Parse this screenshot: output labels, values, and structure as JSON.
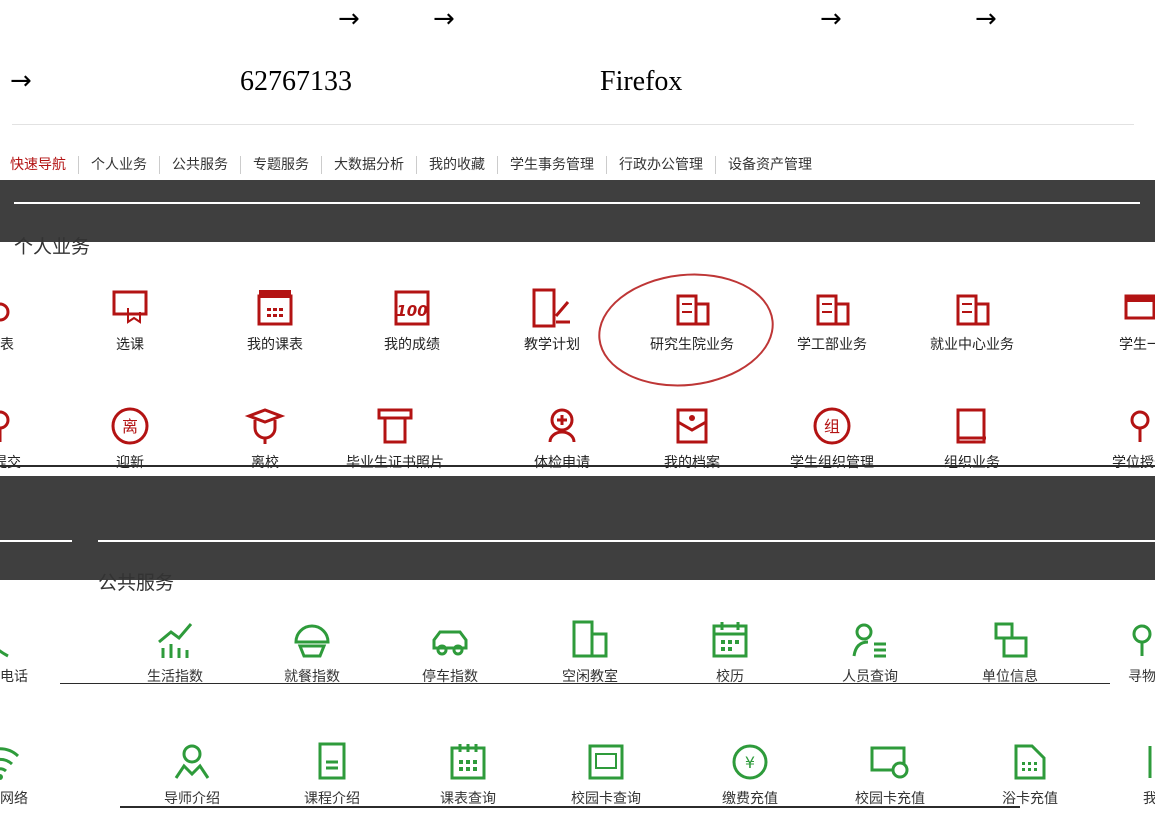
{
  "header": {
    "arrow": "→",
    "phone": "62767133",
    "browser": "Firefox"
  },
  "nav": {
    "tabs": [
      "快速导航",
      "个人业务",
      "公共服务",
      "专题服务",
      "大数据分析",
      "我的收藏",
      "学生事务管理",
      "行政办公管理",
      "设备资产管理"
    ]
  },
  "personal": {
    "title": "个人业务",
    "row1": [
      {
        "label": "张表",
        "icon": "form-icon"
      },
      {
        "label": "选课",
        "icon": "course-select-icon"
      },
      {
        "label": "我的课表",
        "icon": "calendar-icon"
      },
      {
        "label": "我的成绩",
        "icon": "score-100-icon"
      },
      {
        "label": "教学计划",
        "icon": "teaching-plan-icon"
      },
      {
        "label": "研究生院业务",
        "icon": "building-icon"
      },
      {
        "label": "学工部业务",
        "icon": "building-icon"
      },
      {
        "label": "就业中心业务",
        "icon": "building-icon"
      },
      {
        "label": "学生一",
        "icon": "student-icon"
      }
    ],
    "row2": [
      {
        "label": "文提交",
        "icon": "rose-icon"
      },
      {
        "label": "迎新",
        "icon": "leave-icon"
      },
      {
        "label": "离校",
        "icon": "graduate-icon"
      },
      {
        "label": "毕业生证书照片",
        "icon": "certificate-icon"
      },
      {
        "label": "体检申请",
        "icon": "medical-icon"
      },
      {
        "label": "我的档案",
        "icon": "archive-icon"
      },
      {
        "label": "学生组织管理",
        "icon": "group-icon"
      },
      {
        "label": "组织业务",
        "icon": "book-icon"
      },
      {
        "label": "学位授予",
        "icon": "rose-icon"
      }
    ]
  },
  "public": {
    "title": "公共服务",
    "row1": [
      {
        "label": "办公电话",
        "icon": "phone-icon"
      },
      {
        "label": "生活指数",
        "icon": "chart-icon"
      },
      {
        "label": "就餐指数",
        "icon": "dining-icon"
      },
      {
        "label": "停车指数",
        "icon": "car-icon"
      },
      {
        "label": "空闲教室",
        "icon": "classroom-icon"
      },
      {
        "label": "校历",
        "icon": "calendar-icon"
      },
      {
        "label": "人员查询",
        "icon": "person-search-icon"
      },
      {
        "label": "单位信息",
        "icon": "org-icon"
      },
      {
        "label": "寻物",
        "icon": "lost-found-icon"
      }
    ],
    "row2": [
      {
        "label": "校园网络",
        "icon": "wifi-icon"
      },
      {
        "label": "导师介绍",
        "icon": "mentor-icon"
      },
      {
        "label": "课程介绍",
        "icon": "course-icon"
      },
      {
        "label": "课表查询",
        "icon": "schedule-icon"
      },
      {
        "label": "校园卡查询",
        "icon": "card-icon"
      },
      {
        "label": "缴费充值",
        "icon": "payment-icon"
      },
      {
        "label": "校园卡充值",
        "icon": "card-charge-icon"
      },
      {
        "label": "浴卡充值",
        "icon": "bath-card-icon"
      },
      {
        "label": "我",
        "icon": "more-icon"
      }
    ]
  },
  "colors": {
    "red": "#b31313",
    "green": "#2e9b3b",
    "band": "#3f3f3f"
  }
}
